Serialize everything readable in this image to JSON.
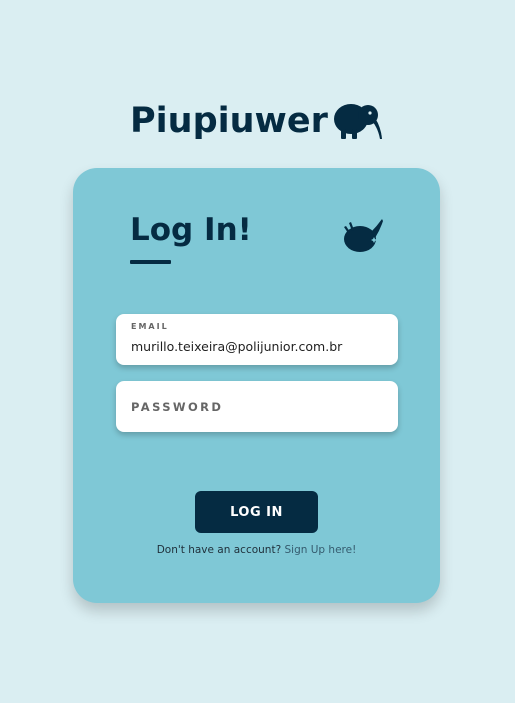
{
  "brand": {
    "title": "Piupiuwer",
    "icon": "kiwi-bird-icon"
  },
  "login_card": {
    "title": "Log In!",
    "icon": "kiwi-bird-head-icon",
    "email": {
      "label": "EMAIL",
      "value": "murillo.teixeira@polijunior.com.br"
    },
    "password": {
      "placeholder": "PASSWORD",
      "value": ""
    },
    "submit_label": "LOG IN",
    "signup_prompt": "Don't have an account?",
    "signup_link": "Sign Up here!"
  },
  "colors": {
    "page_background": "#daeef2",
    "card_background": "#7fc8d6",
    "primary_dark": "#052b42",
    "input_background": "#ffffff"
  }
}
